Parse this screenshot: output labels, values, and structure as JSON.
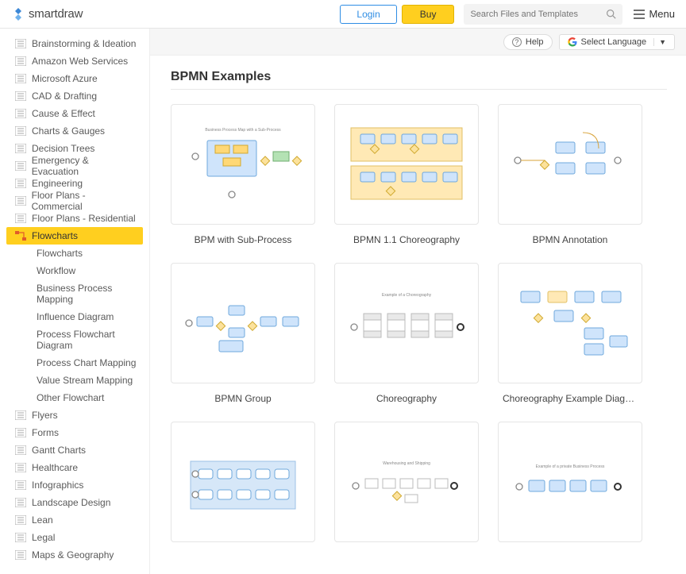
{
  "header": {
    "brand": "smartdraw",
    "login": "Login",
    "buy": "Buy",
    "search_placeholder": "Search Files and Templates",
    "menu": "Menu"
  },
  "subheader": {
    "help": "Help",
    "select_lang": "Select Language"
  },
  "sidebar": {
    "categories": [
      {
        "label": "Brainstorming & Ideation",
        "active": false
      },
      {
        "label": "Amazon Web Services",
        "active": false
      },
      {
        "label": "Microsoft Azure",
        "active": false
      },
      {
        "label": "CAD & Drafting",
        "active": false
      },
      {
        "label": "Cause & Effect",
        "active": false
      },
      {
        "label": "Charts & Gauges",
        "active": false
      },
      {
        "label": "Decision Trees",
        "active": false
      },
      {
        "label": "Emergency & Evacuation",
        "active": false
      },
      {
        "label": "Engineering",
        "active": false
      },
      {
        "label": "Floor Plans - Commercial",
        "active": false
      },
      {
        "label": "Floor Plans - Residential",
        "active": false
      },
      {
        "label": "Flowcharts",
        "active": true
      },
      {
        "label": "Flyers",
        "active": false
      },
      {
        "label": "Forms",
        "active": false
      },
      {
        "label": "Gantt Charts",
        "active": false
      },
      {
        "label": "Healthcare",
        "active": false
      },
      {
        "label": "Infographics",
        "active": false
      },
      {
        "label": "Landscape Design",
        "active": false
      },
      {
        "label": "Lean",
        "active": false
      },
      {
        "label": "Legal",
        "active": false
      },
      {
        "label": "Maps & Geography",
        "active": false
      }
    ],
    "subcategories": [
      "Flowcharts",
      "Workflow",
      "Business Process Mapping",
      "Influence Diagram",
      "Process Flowchart Diagram",
      "Process Chart Mapping",
      "Value Stream Mapping",
      "Other Flowchart"
    ]
  },
  "content": {
    "title": "BPMN Examples",
    "cards": [
      {
        "label": "BPM with Sub-Process"
      },
      {
        "label": "BPMN 1.1 Choreography"
      },
      {
        "label": "BPMN Annotation"
      },
      {
        "label": "BPMN Group"
      },
      {
        "label": "Choreography"
      },
      {
        "label": "Choreography Example Diagr…"
      },
      {
        "label": ""
      },
      {
        "label": ""
      },
      {
        "label": ""
      }
    ]
  },
  "colors": {
    "accent_yellow": "#ffcf1f",
    "accent_blue": "#2f8de4",
    "bp_fill": "#cfe4fb",
    "bp_stroke": "#6fa8dc",
    "lane_fill": "#ffe9b5"
  }
}
